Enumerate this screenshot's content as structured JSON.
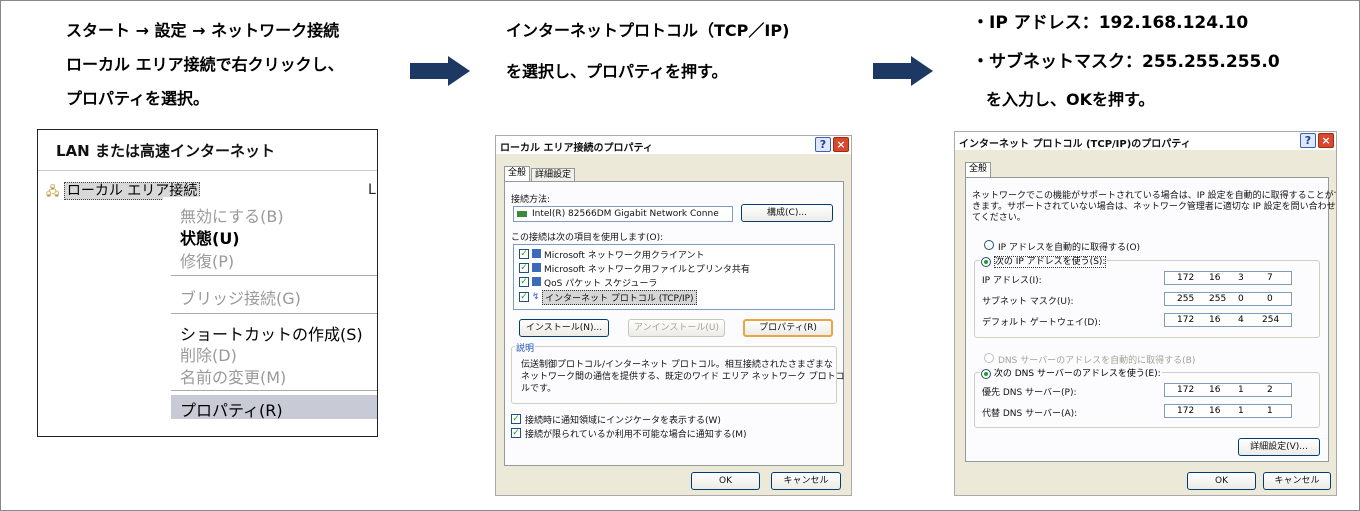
{
  "steps": {
    "step1": [
      "スタート → 設定 → ネットワーク接続",
      "ローカル エリア接続で右クリックし、",
      "プロパティを選択。"
    ],
    "step2": [
      "インターネットプロトコル（TCP／IP)",
      "を選択し、プロパティを押す。"
    ],
    "step3": [
      "・IP アドレス：192.168.124.10",
      "・サブネットマスク：255.255.255.0",
      "を入力し、OKを押す。"
    ]
  },
  "colors": {
    "arrow": "#1e3864",
    "menu_highlight": "#c8cbd6",
    "dialog_bg": "#ece9d8"
  },
  "context_panel": {
    "title": "LAN または高速インターネット",
    "connection": "ローカル エリア接続",
    "right_edge": "L",
    "menu": [
      {
        "label": "無効にする(B)",
        "disabled": true
      },
      {
        "label": "状態(U)",
        "bold": true
      },
      {
        "label": "修復(P)",
        "disabled": true
      },
      {
        "label": "ブリッジ接続(G)",
        "disabled": true
      },
      {
        "label": "ショートカットの作成(S)"
      },
      {
        "label": "削除(D)",
        "disabled": true
      },
      {
        "label": "名前の変更(M)",
        "disabled": true
      },
      {
        "label": "プロパティ(R)",
        "highlighted": true
      }
    ]
  },
  "dialog1": {
    "title": "ローカル エリア接続のプロパティ",
    "tabs": [
      "全般",
      "詳細設定"
    ],
    "connect_using_label": "接続方法:",
    "adapter": "Intel(R) 82566DM Gigabit Network Conne",
    "configure_button": "構成(C)...",
    "items_label": "この接続は次の項目を使用します(O):",
    "items": [
      "Microsoft ネットワーク用クライアント",
      "Microsoft ネットワーク用ファイルとプリンタ共有",
      "QoS パケット スケジューラ",
      "インターネット プロトコル (TCP/IP)"
    ],
    "install_button": "インストール(N)...",
    "uninstall_button": "アンインストール(U)",
    "properties_button": "プロパティ(R)",
    "description_label": "説明",
    "description": [
      "伝送制御プロトコル/インターネット プロトコル。相互接続されたさまざまな",
      "ネットワーク間の通信を提供する、既定のワイド エリア ネットワーク プロトコ",
      "ルです。"
    ],
    "check1": "接続時に通知領域にインジケータを表示する(W)",
    "check2": "接続が限られているか利用不可能な場合に通知する(M)",
    "ok": "OK",
    "cancel": "キャンセル"
  },
  "dialog2": {
    "title": "インターネット プロトコル (TCP/IP)のプロパティ",
    "tab": "全般",
    "intro": [
      "ネットワークでこの機能がサポートされている場合は、IP 設定を自動的に取得することがで",
      "きます。サポートされていない場合は、ネットワーク管理者に適切な IP 設定を問い合わせ",
      "てください。"
    ],
    "auto_ip": "IP アドレスを自動的に取得する(O)",
    "manual_ip": "次の IP アドレスを使う(S):",
    "ip_label": "IP アドレス(I):",
    "ip": [
      "172",
      "16",
      "3",
      "7"
    ],
    "mask_label": "サブネット マスク(U):",
    "mask": [
      "255",
      "255",
      "0",
      "0"
    ],
    "gw_label": "デフォルト ゲートウェイ(D):",
    "gw": [
      "172",
      "16",
      "4",
      "254"
    ],
    "auto_dns": "DNS サーバーのアドレスを自動的に取得する(B)",
    "manual_dns": "次の DNS サーバーのアドレスを使う(E):",
    "dns1_label": "優先 DNS サーバー(P):",
    "dns1": [
      "172",
      "16",
      "1",
      "2"
    ],
    "dns2_label": "代替 DNS サーバー(A):",
    "dns2": [
      "172",
      "16",
      "1",
      "1"
    ],
    "advanced_button": "詳細設定(V)...",
    "ok": "OK",
    "cancel": "キャンセル"
  }
}
